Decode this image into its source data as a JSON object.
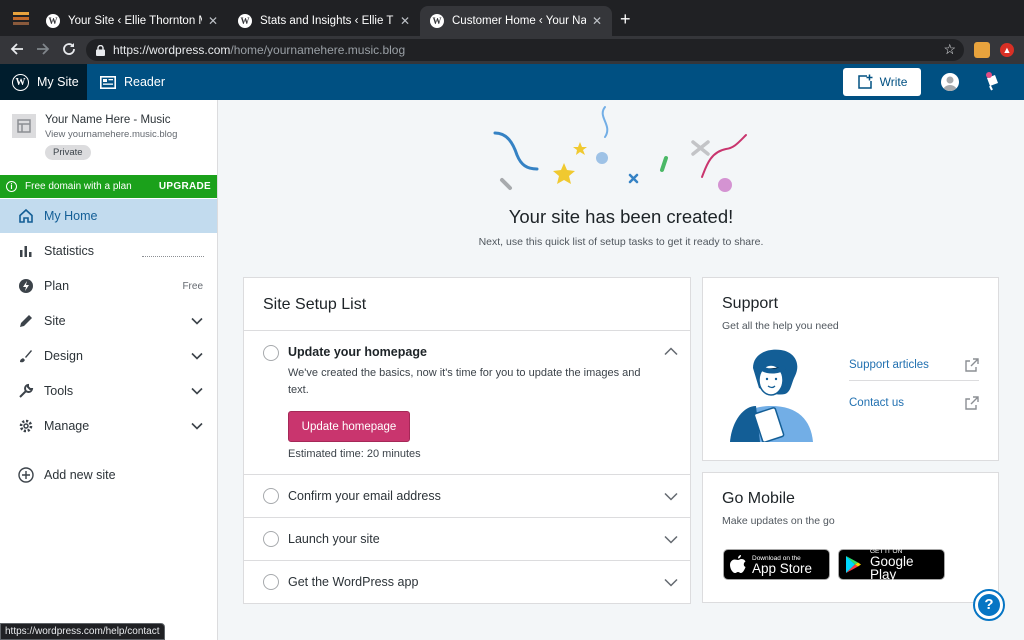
{
  "browser": {
    "tabs": [
      {
        "title": "Your Site ‹ Ellie Thornton Music"
      },
      {
        "title": "Stats and Insights ‹ Ellie Thornton"
      },
      {
        "title": "Customer Home ‹ Your Name H"
      }
    ],
    "url_base": "https://wordpress.com",
    "url_path": "/home/yournamehere.music.blog"
  },
  "masterbar": {
    "my_site": "My Site",
    "reader": "Reader",
    "write": "Write"
  },
  "sidebar": {
    "site_name": "Your Name Here - Music",
    "site_url": "View yournamehere.music.blog",
    "badge": "Private",
    "banner_text": "Free domain with a plan",
    "banner_action": "UPGRADE",
    "items": [
      {
        "label": "My Home",
        "icon": "home-icon"
      },
      {
        "label": "Statistics",
        "icon": "bar-chart-icon"
      },
      {
        "label": "Plan",
        "icon": "plan-bolt-icon",
        "note": "Free"
      },
      {
        "label": "Site",
        "icon": "pencil-icon"
      },
      {
        "label": "Design",
        "icon": "design-brush-icon"
      },
      {
        "label": "Tools",
        "icon": "wrench-icon"
      },
      {
        "label": "Manage",
        "icon": "gear-icon"
      },
      {
        "label": "Add new site",
        "icon": "add-circle-icon"
      }
    ]
  },
  "hero": {
    "title": "Your site has been created!",
    "subtitle": "Next, use this quick list of setup tasks to get it ready to share."
  },
  "setup": {
    "title": "Site Setup List",
    "expanded": {
      "title": "Update your homepage",
      "description": "We've created the basics, now it's time for you to update the images and text.",
      "button": "Update homepage",
      "estimate": "Estimated time: 20 minutes"
    },
    "tasks": [
      "Confirm your email address",
      "Launch your site",
      "Get the WordPress app"
    ]
  },
  "support": {
    "title": "Support",
    "subtitle": "Get all the help you need",
    "links": [
      "Support articles",
      "Contact us"
    ]
  },
  "mobile": {
    "title": "Go Mobile",
    "subtitle": "Make updates on the go",
    "app_store_small": "Download on the",
    "app_store_big": "App Store",
    "google_small": "GET IT ON",
    "google_big": "Google Play"
  },
  "statusbar": "https://wordpress.com/help/contact",
  "colors": {
    "accent_pink": "#c9356e",
    "masterbar_blue": "#005082",
    "green_banner": "#1ba11b",
    "link_blue": "#2271b1"
  }
}
